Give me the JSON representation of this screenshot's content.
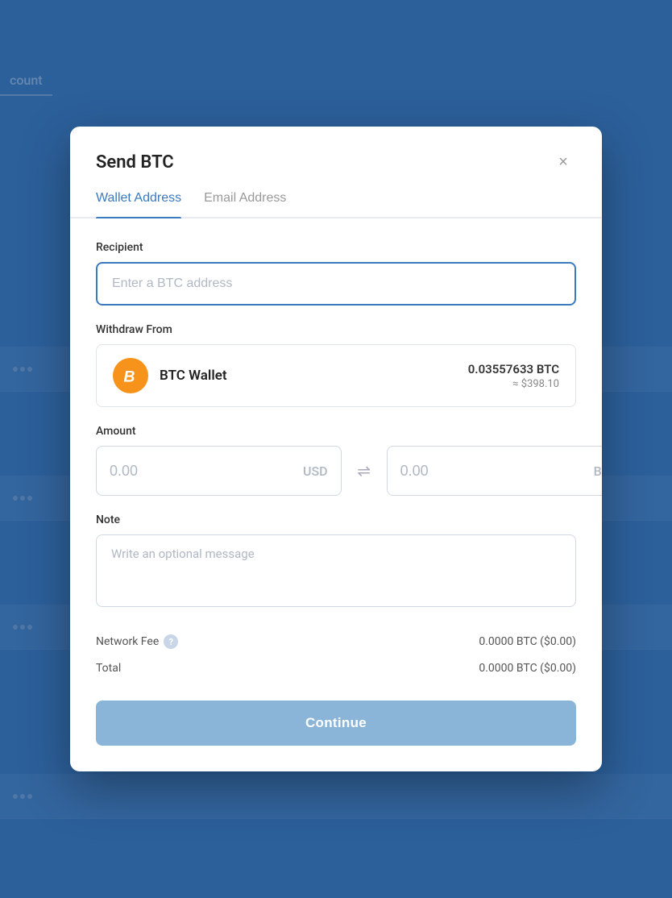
{
  "background": {
    "label": "count"
  },
  "modal": {
    "title": "Send BTC",
    "close_label": "×",
    "tabs": [
      {
        "id": "wallet",
        "label": "Wallet Address",
        "active": true
      },
      {
        "id": "email",
        "label": "Email Address",
        "active": false
      }
    ],
    "recipient_label": "Recipient",
    "recipient_placeholder": "Enter a BTC address",
    "withdraw_label": "Withdraw From",
    "wallet_name": "BTC Wallet",
    "wallet_btc_balance": "0.03557633 BTC",
    "wallet_usd_balance": "≈ $398.10",
    "btc_symbol": "₿",
    "amount_label": "Amount",
    "amount_usd_value": "0.00",
    "amount_usd_currency": "USD",
    "amount_btc_value": "0.00",
    "amount_btc_currency": "BTC",
    "note_label": "Note",
    "note_placeholder": "Write an optional message",
    "network_fee_label": "Network Fee",
    "network_fee_value": "0.0000 BTC ($0.00)",
    "total_label": "Total",
    "total_value": "0.0000 BTC ($0.00)",
    "continue_label": "Continue",
    "help_icon_label": "?"
  }
}
